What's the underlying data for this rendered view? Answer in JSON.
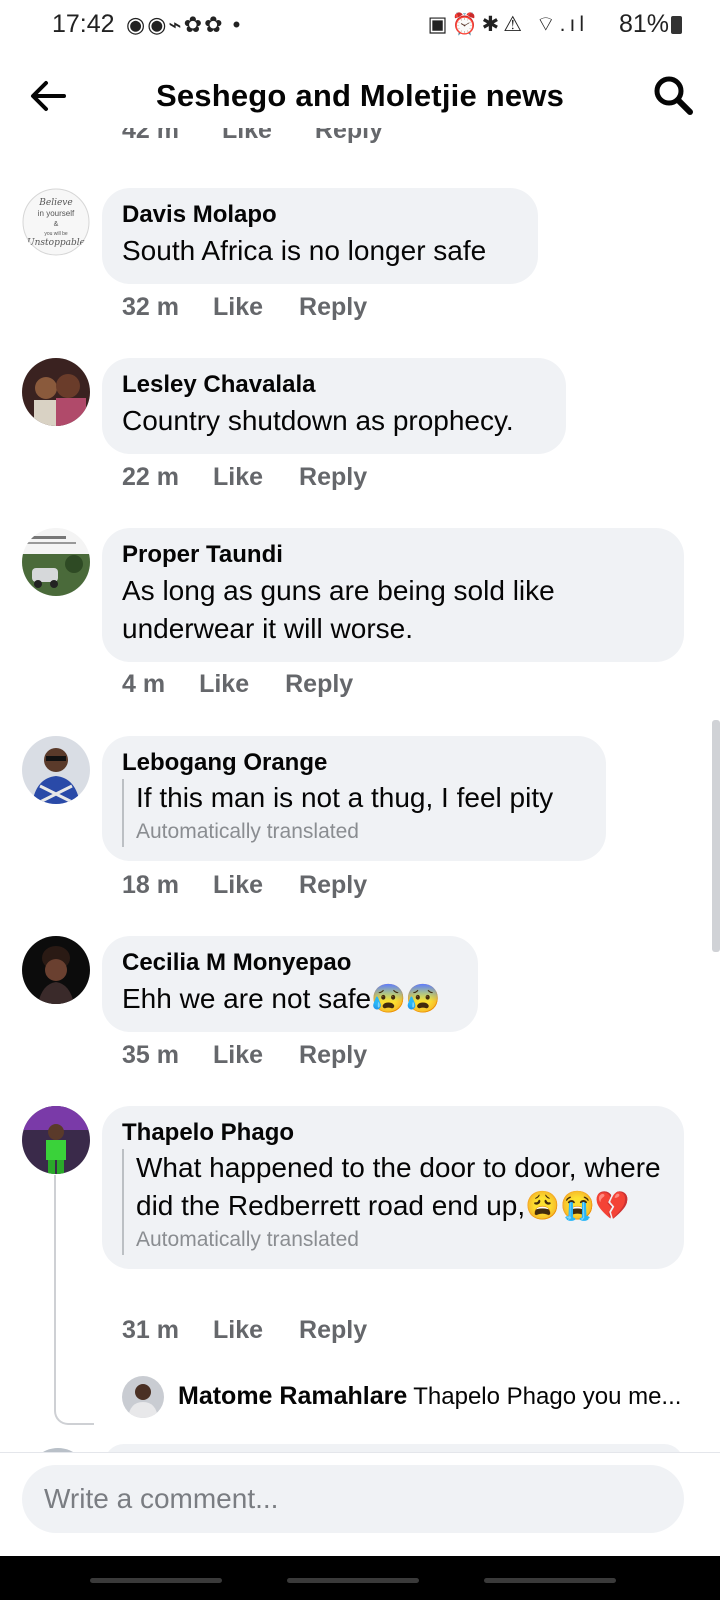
{
  "status_bar": {
    "time": "17:42",
    "left_icons": "◉◉⌁✿✿ •",
    "right_icons": "▣⏰✱⚠ ⌔.ıl",
    "battery": "81%"
  },
  "header": {
    "title": "Seshego and Moletjie news"
  },
  "cut_meta": {
    "time": "42 m",
    "like": "Like",
    "reply": "Reply"
  },
  "comments": [
    {
      "author": "Davis Molapo",
      "text": "South Africa is no longer safe",
      "time": "32 m",
      "like": "Like",
      "reply": "Reply",
      "avatar_text": "Believe in yourself & you will be Unstoppable"
    },
    {
      "author": "Lesley Chavalala",
      "text": "Country shutdown as prophecy.",
      "time": "22 m",
      "like": "Like",
      "reply": "Reply"
    },
    {
      "author": "Proper Taundi",
      "text": "As long as guns are being sold like underwear it will worse.",
      "time": "4 m",
      "like": "Like",
      "reply": "Reply"
    },
    {
      "author": "Lebogang Orange",
      "text": "If this man is not a thug, I feel pity",
      "translated_note": "Automatically translated",
      "time": "18 m",
      "like": "Like",
      "reply": "Reply"
    },
    {
      "author": "Cecilia M Monyepao",
      "text": "Ehh we are not safe😰😰",
      "time": "35 m",
      "like": "Like",
      "reply": "Reply"
    },
    {
      "author": "Thapelo Phago",
      "text": "What happened to the door to door, where did the Redberrett road end up,😩😭💔",
      "translated_note": "Automatically translated",
      "time": "31 m",
      "like": "Like",
      "reply": "Reply"
    }
  ],
  "reply_preview": {
    "author": "Matome Ramahlare",
    "text": "Thapelo Phago you me..."
  },
  "composer": {
    "placeholder": "Write a comment..."
  }
}
